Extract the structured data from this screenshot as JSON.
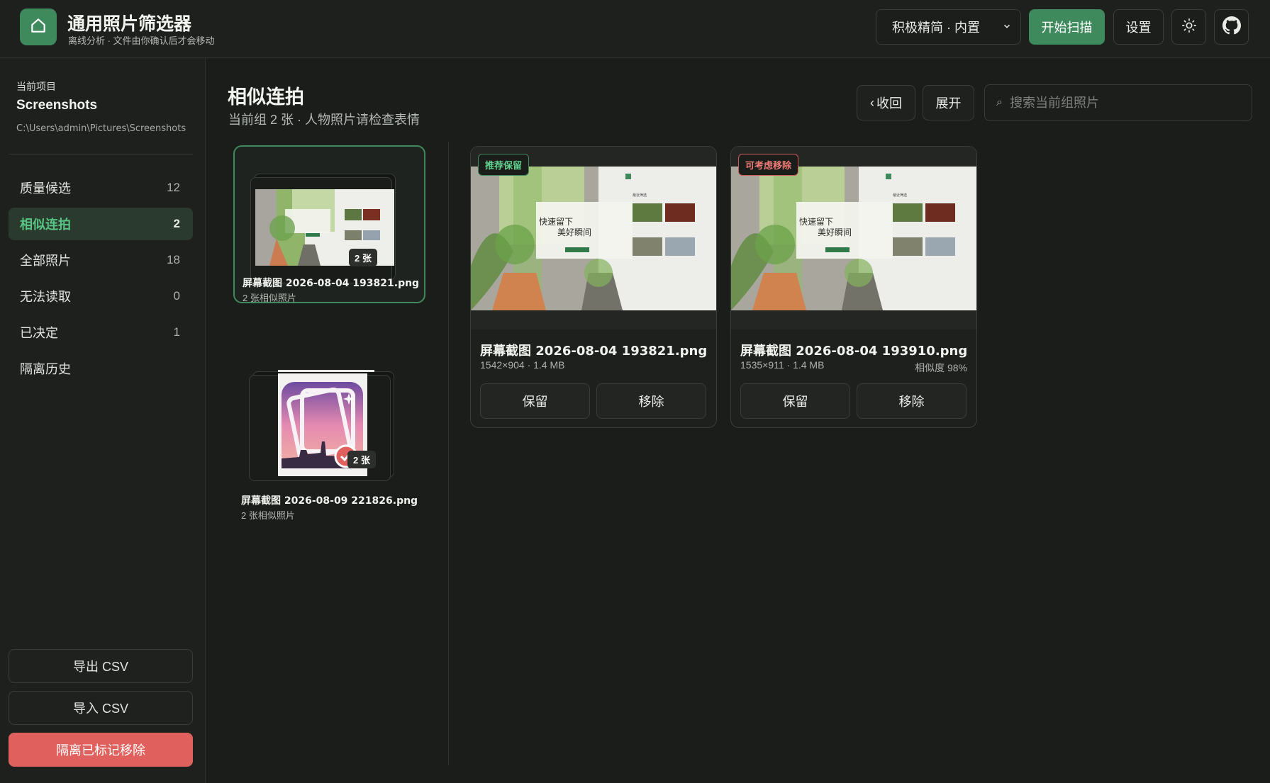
{
  "app": {
    "title": "通用照片筛选器",
    "subtitle": "离线分析 · 文件由你确认后才会移动",
    "mode": "积极精简 · 内置",
    "scan_label": "开始扫描",
    "settings_label": "设置"
  },
  "sidebar": {
    "project_label": "当前项目",
    "project_name": "Screenshots",
    "project_path": "C:\\Users\\admin\\Pictures\\Screenshots",
    "items": [
      {
        "label": "质量候选",
        "count": "12"
      },
      {
        "label": "相似连拍",
        "count": "2"
      },
      {
        "label": "全部照片",
        "count": "18"
      },
      {
        "label": "无法读取",
        "count": "0"
      },
      {
        "label": "已决定",
        "count": "1"
      },
      {
        "label": "隔离历史",
        "count": ""
      }
    ],
    "export_label": "导出 CSV",
    "import_label": "导入 CSV",
    "quarantine_label": "隔离已标记移除"
  },
  "main": {
    "title": "相似连拍",
    "subtitle": "当前组 2 张 · 人物照片请检查表情",
    "collapse_label": "收回",
    "expand_label": "展开",
    "search_placeholder": "搜索当前组照片"
  },
  "groups": [
    {
      "name": "屏幕截图 2026-08-04 193821.png",
      "meta": "2 张相似照片",
      "badge": "2 张"
    },
    {
      "name": "屏幕截图 2026-08-09 221826.png",
      "meta": "2 张相似照片",
      "badge": "2 张"
    }
  ],
  "thumb_text": {
    "line1": "快速留下",
    "line2": "美好瞬间",
    "small_label": "最近筛选"
  },
  "photos": [
    {
      "tag": "推荐保留",
      "name": "屏幕截图 2026-08-04 193821.png",
      "meta": "1542×904 · 1.4 MB",
      "similarity": "",
      "keep_label": "保留",
      "remove_label": "移除"
    },
    {
      "tag": "可考虑移除",
      "name": "屏幕截图 2026-08-04 193910.png",
      "meta": "1535×911 · 1.4 MB",
      "similarity": "相似度 98%",
      "keep_label": "保留",
      "remove_label": "移除"
    }
  ],
  "colors": {
    "accent": "#3f8a5c",
    "danger": "#e0605d",
    "background": "#1b1d1b"
  }
}
